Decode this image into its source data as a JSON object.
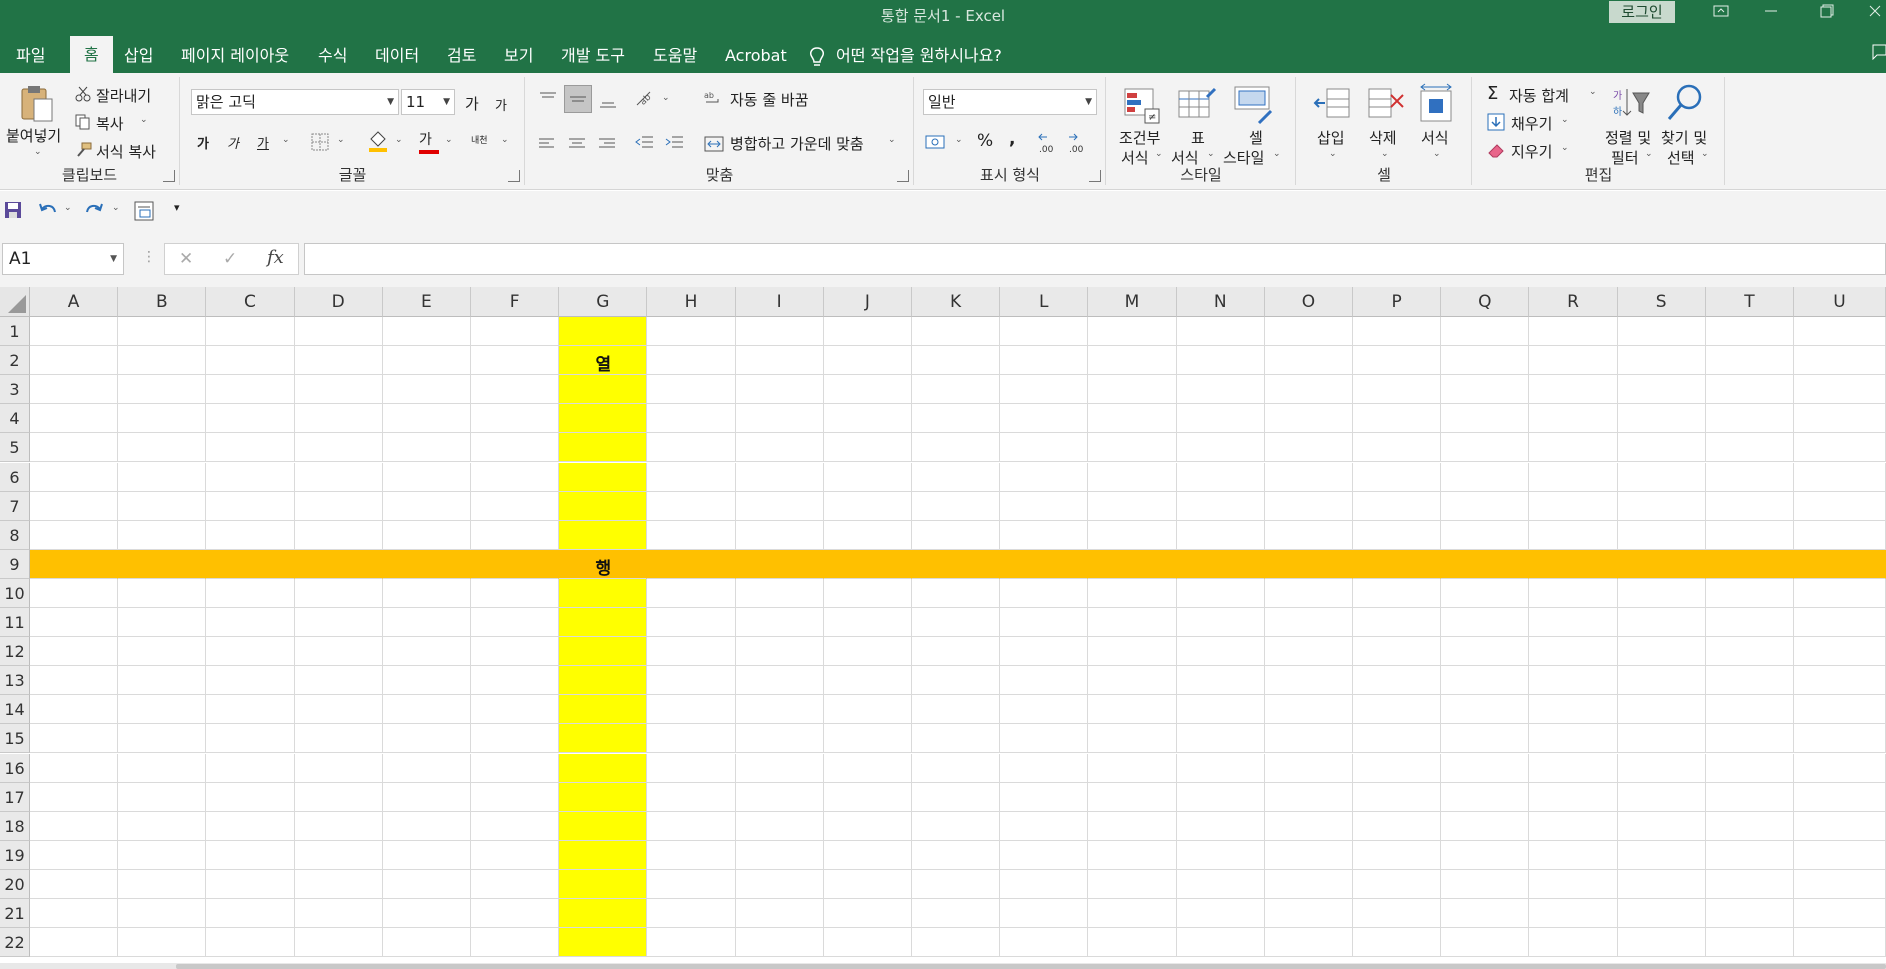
{
  "window": {
    "title": "통합 문서1  -  Excel",
    "login_label": "로그인"
  },
  "tabs": [
    {
      "label": "파일"
    },
    {
      "label": "홈",
      "active": true
    },
    {
      "label": "삽입"
    },
    {
      "label": "페이지 레이아웃"
    },
    {
      "label": "수식"
    },
    {
      "label": "데이터"
    },
    {
      "label": "검토"
    },
    {
      "label": "보기"
    },
    {
      "label": "개발 도구"
    },
    {
      "label": "도움말"
    },
    {
      "label": "Acrobat"
    }
  ],
  "tell_me": "어떤 작업을 원하시나요?",
  "clipboard": {
    "paste": "붙여넣기",
    "cut": "잘라내기",
    "copy": "복사",
    "format_painter": "서식 복사",
    "label": "클립보드"
  },
  "font": {
    "name": "맑은 고딕",
    "size": "11",
    "grow": "가",
    "shrink": "가",
    "bold": "가",
    "italic": "가",
    "underline": "가",
    "font_color_glyph": "가",
    "phonetic": "내천",
    "label": "글꼴",
    "accent_fill": "#ffc000",
    "accent_font": "#e00000"
  },
  "alignment": {
    "wrap_text": "자동 줄 바꿈",
    "merge_center": "병합하고 가운데 맞춤",
    "label": "맞춤"
  },
  "number": {
    "format": "일반",
    "percent": "%",
    "comma": ",",
    "inc_decimal": ".00",
    "dec_decimal": ".00",
    "label": "표시 형식"
  },
  "styles": {
    "conditional_1": "조건부",
    "conditional_2": "서식",
    "table_1": "표",
    "table_2": "서식",
    "cell_1": "셀",
    "cell_2": "스타일",
    "label": "스타일"
  },
  "cells": {
    "insert": "삽입",
    "delete": "삭제",
    "format": "서식",
    "label": "셀"
  },
  "editing": {
    "autosum": "자동 합계",
    "fill": "채우기",
    "clear": "지우기",
    "sort_1": "정렬 및",
    "sort_2": "필터",
    "find_1": "찾기 및",
    "find_2": "선택",
    "label": "편집"
  },
  "formula_bar": {
    "name_box": "A1",
    "fx": "fx",
    "value": ""
  },
  "sheet": {
    "columns": [
      "A",
      "B",
      "C",
      "D",
      "E",
      "F",
      "G",
      "H",
      "I",
      "J",
      "K",
      "L",
      "M",
      "N",
      "O",
      "P",
      "Q",
      "R",
      "S",
      "T",
      "U"
    ],
    "rows": [
      "1",
      "2",
      "3",
      "4",
      "5",
      "6",
      "7",
      "8",
      "9",
      "10",
      "11",
      "12",
      "13",
      "14",
      "15",
      "16",
      "17",
      "18",
      "19",
      "20",
      "21",
      "22"
    ],
    "highlight_column": "G",
    "highlight_column_color": "#ffff00",
    "highlight_row": "9",
    "highlight_row_color": "#ffc000",
    "cell_G2": "열",
    "cell_G9": "행"
  }
}
